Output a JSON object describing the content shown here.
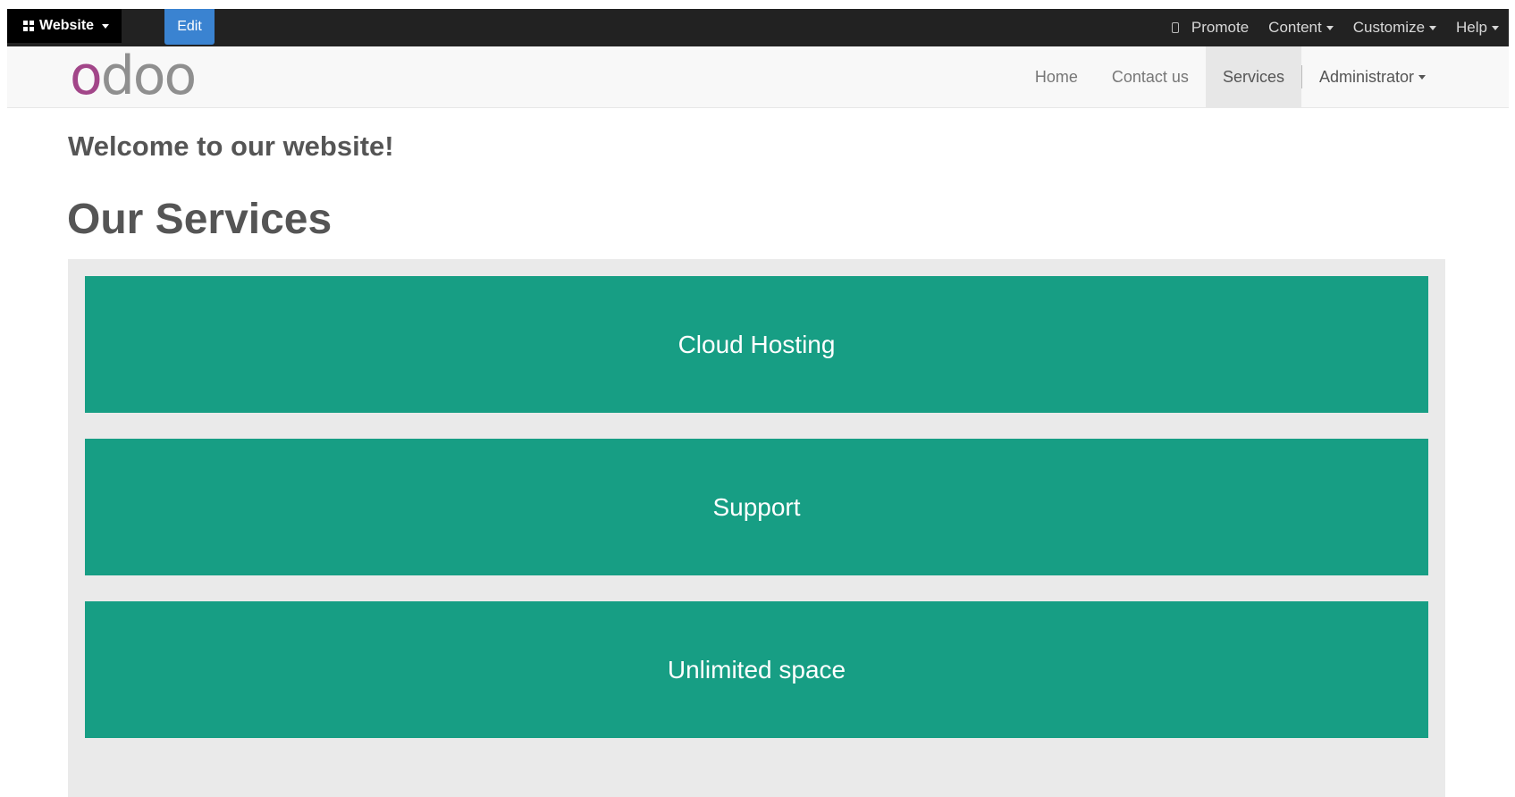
{
  "admin_bar": {
    "website_label": "Website",
    "edit_label": "Edit",
    "promote_label": "Promote",
    "content_label": "Content",
    "customize_label": "Customize",
    "help_label": "Help"
  },
  "navbar": {
    "logo": {
      "first_letter": "o",
      "rest": "doo"
    },
    "menu": {
      "home": "Home",
      "contact": "Contact us",
      "services": "Services",
      "admin": "Administrator"
    },
    "active_item": "Services"
  },
  "page": {
    "welcome": "Welcome to our website!",
    "title": "Our Services",
    "services": [
      "Cloud Hosting",
      "Support",
      "Unlimited space"
    ]
  },
  "colors": {
    "admin_bar": "#222222",
    "edit_button": "#3a83d1",
    "logo_accent": "#a24689",
    "service_card": "#179e84",
    "services_background": "#eaeaea"
  },
  "icons": [
    "grid-icon",
    "mobile-icon",
    "caret-down-icon"
  ]
}
